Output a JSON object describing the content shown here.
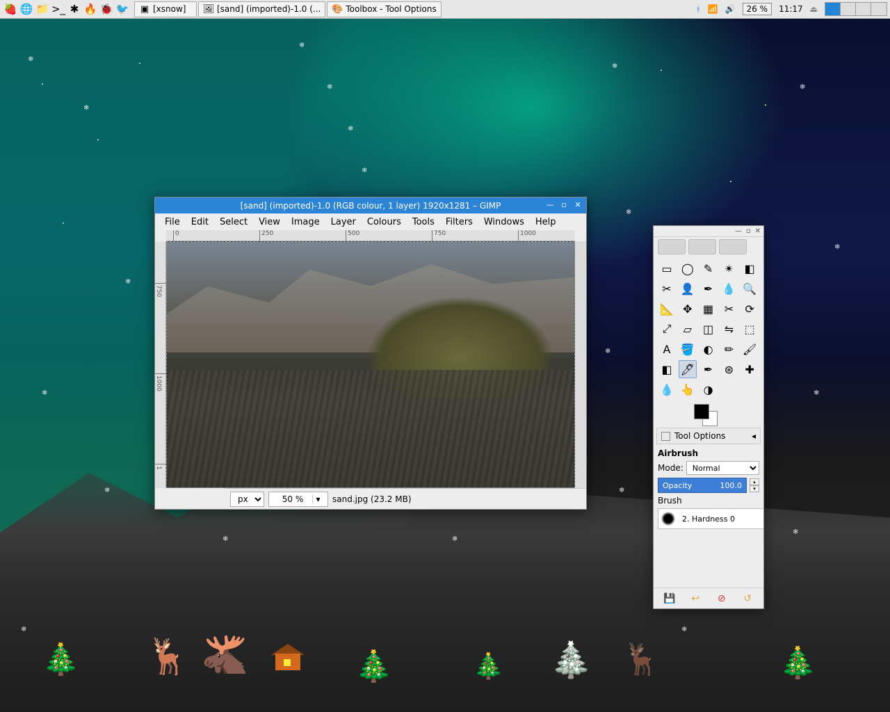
{
  "taskbar": {
    "launchers": [
      {
        "name": "menu-icon",
        "glyph": "🍓"
      },
      {
        "name": "browser-icon",
        "glyph": "🌐"
      },
      {
        "name": "files-icon",
        "glyph": "📁"
      },
      {
        "name": "terminal-icon",
        "glyph": ">_"
      },
      {
        "name": "app1-icon",
        "glyph": "✱"
      },
      {
        "name": "app2-icon",
        "glyph": "🔥"
      },
      {
        "name": "app3-icon",
        "glyph": "🐞"
      },
      {
        "name": "app4-icon",
        "glyph": "🐦"
      }
    ],
    "tasks": [
      {
        "name": "task-xsnow",
        "icon": "▣",
        "label": "[xsnow]"
      },
      {
        "name": "task-gimp-image",
        "icon": "🖼",
        "label": "[sand] (imported)-1.0 (..."
      },
      {
        "name": "task-gimp-toolbox",
        "icon": "🎨",
        "label": "Toolbox - Tool Options"
      }
    ],
    "tray": {
      "bluetooth": "ᚼ",
      "wifi": "📶",
      "volume": "🔊",
      "battery": "26 %",
      "clock": "11:17",
      "eject": "⏏"
    }
  },
  "gimp": {
    "title": "[sand] (imported)-1.0 (RGB colour, 1 layer) 1920x1281 – GIMP",
    "menu": [
      "File",
      "Edit",
      "Select",
      "View",
      "Image",
      "Layer",
      "Colours",
      "Tools",
      "Filters",
      "Windows",
      "Help"
    ],
    "ruler_h": [
      "0",
      "250",
      "500",
      "750",
      "1000"
    ],
    "ruler_v": [
      "750",
      "1000",
      "1"
    ],
    "unit": "px",
    "zoom": "50 %",
    "status": "sand.jpg (23.2 MB)"
  },
  "toolbox": {
    "tool_options_label": "Tool Options",
    "active_tool": "Airbrush",
    "mode_label": "Mode:",
    "mode_value": "Normal",
    "opacity_label": "Opacity",
    "opacity_value": "100.0",
    "brush_label": "Brush",
    "brush_value": "2. Hardness 0",
    "tools": [
      {
        "n": "rect-select-icon",
        "g": "▭"
      },
      {
        "n": "ellipse-select-icon",
        "g": "◯"
      },
      {
        "n": "free-select-icon",
        "g": "✎"
      },
      {
        "n": "fuzzy-select-icon",
        "g": "✴"
      },
      {
        "n": "by-color-select-icon",
        "g": "◧"
      },
      {
        "n": "scissors-icon",
        "g": "✂"
      },
      {
        "n": "foreground-select-icon",
        "g": "👤"
      },
      {
        "n": "paths-icon",
        "g": "✒"
      },
      {
        "n": "color-picker-icon",
        "g": "💧"
      },
      {
        "n": "zoom-icon",
        "g": "🔍"
      },
      {
        "n": "measure-icon",
        "g": "📐"
      },
      {
        "n": "move-icon",
        "g": "✥"
      },
      {
        "n": "align-icon",
        "g": "▦"
      },
      {
        "n": "crop-icon",
        "g": "✂"
      },
      {
        "n": "rotate-icon",
        "g": "⟳"
      },
      {
        "n": "scale-icon",
        "g": "⤢"
      },
      {
        "n": "shear-icon",
        "g": "▱"
      },
      {
        "n": "perspective-icon",
        "g": "◫"
      },
      {
        "n": "flip-icon",
        "g": "⇋"
      },
      {
        "n": "cage-icon",
        "g": "⬚"
      },
      {
        "n": "text-icon",
        "g": "A"
      },
      {
        "n": "bucket-icon",
        "g": "🪣"
      },
      {
        "n": "blend-icon",
        "g": "◐"
      },
      {
        "n": "pencil-icon",
        "g": "✏"
      },
      {
        "n": "paintbrush-icon",
        "g": "🖌"
      },
      {
        "n": "eraser-icon",
        "g": "◧"
      },
      {
        "n": "airbrush-icon",
        "g": "🖊",
        "sel": true
      },
      {
        "n": "ink-icon",
        "g": "✒"
      },
      {
        "n": "clone-icon",
        "g": "⊛"
      },
      {
        "n": "heal-icon",
        "g": "✚"
      },
      {
        "n": "blur-icon",
        "g": "💧"
      },
      {
        "n": "smudge-icon",
        "g": "👆"
      },
      {
        "n": "dodge-icon",
        "g": "◑"
      }
    ]
  },
  "colors": {
    "accent": "#2b84d6",
    "panel": "#ededed"
  }
}
